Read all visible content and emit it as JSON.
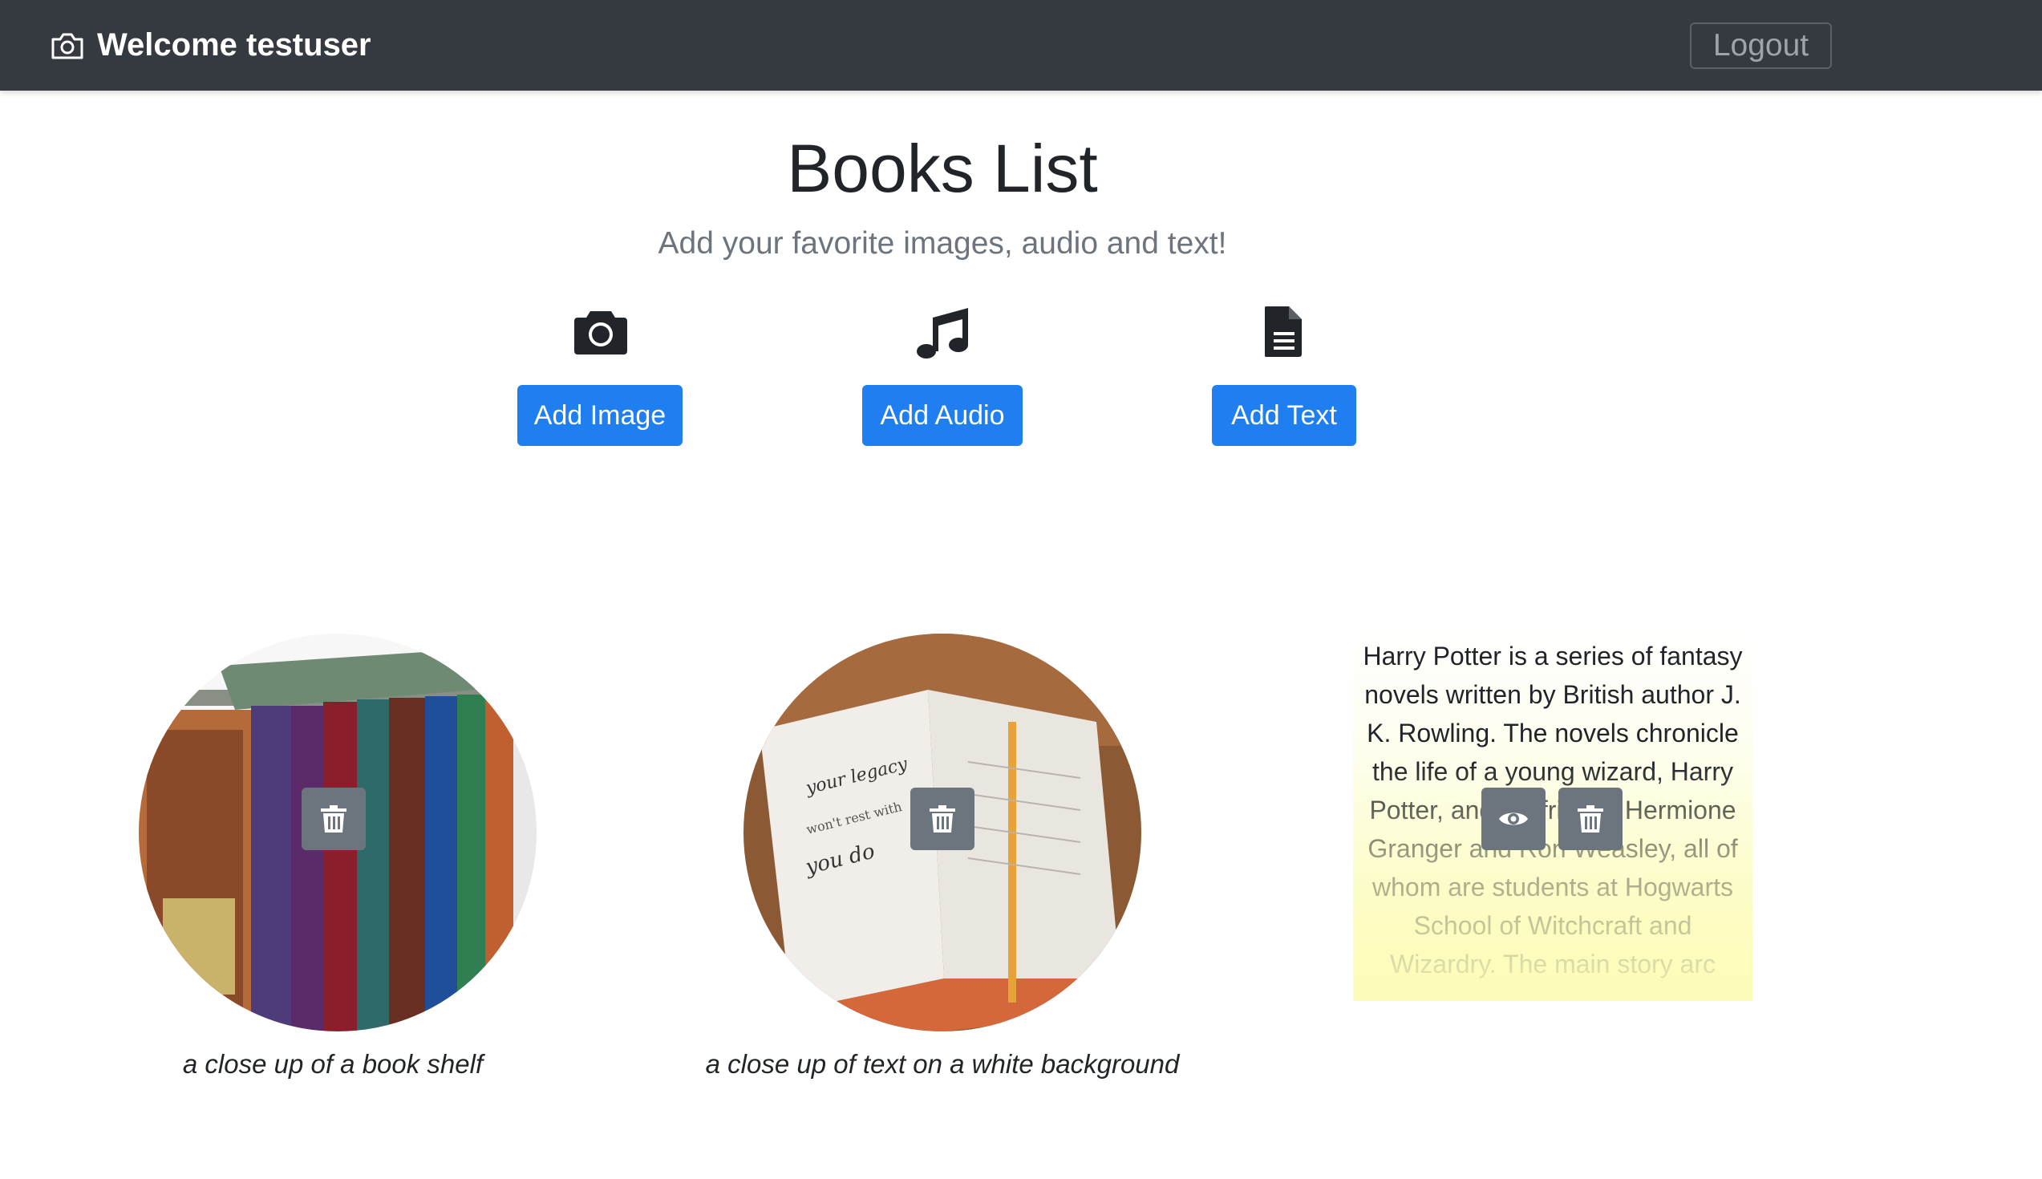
{
  "navbar": {
    "brand_icon": "camera-icon",
    "brand_text": "Welcome testuser",
    "logout_label": "Logout"
  },
  "header": {
    "title": "Books List",
    "subtitle": "Add your favorite images, audio and text!"
  },
  "actions": [
    {
      "icon": "camera-icon",
      "label": "Add Image"
    },
    {
      "icon": "music-note-icon",
      "label": "Add Audio"
    },
    {
      "icon": "document-icon",
      "label": "Add Text"
    }
  ],
  "cards": [
    {
      "type": "image",
      "caption": "a close up of a book shelf",
      "delete_icon": "trash-icon"
    },
    {
      "type": "image",
      "caption": "a close up of text on a white background",
      "delete_icon": "trash-icon"
    },
    {
      "type": "text",
      "text": "Harry Potter is a series of fantasy novels written by British author J. K. Rowling. The novels chronicle the life of a young wizard, Harry Potter, and his friends Hermione Granger and Ron Weasley, all of whom are students at Hogwarts School of Witchcraft and Wizardry. The main story arc",
      "view_icon": "eye-icon",
      "delete_icon": "trash-icon"
    }
  ],
  "colors": {
    "navbar_bg": "#343a40",
    "primary": "#1f7ff0",
    "secondary": "#6c757d",
    "text_card_highlight": "#fbfbb4"
  }
}
